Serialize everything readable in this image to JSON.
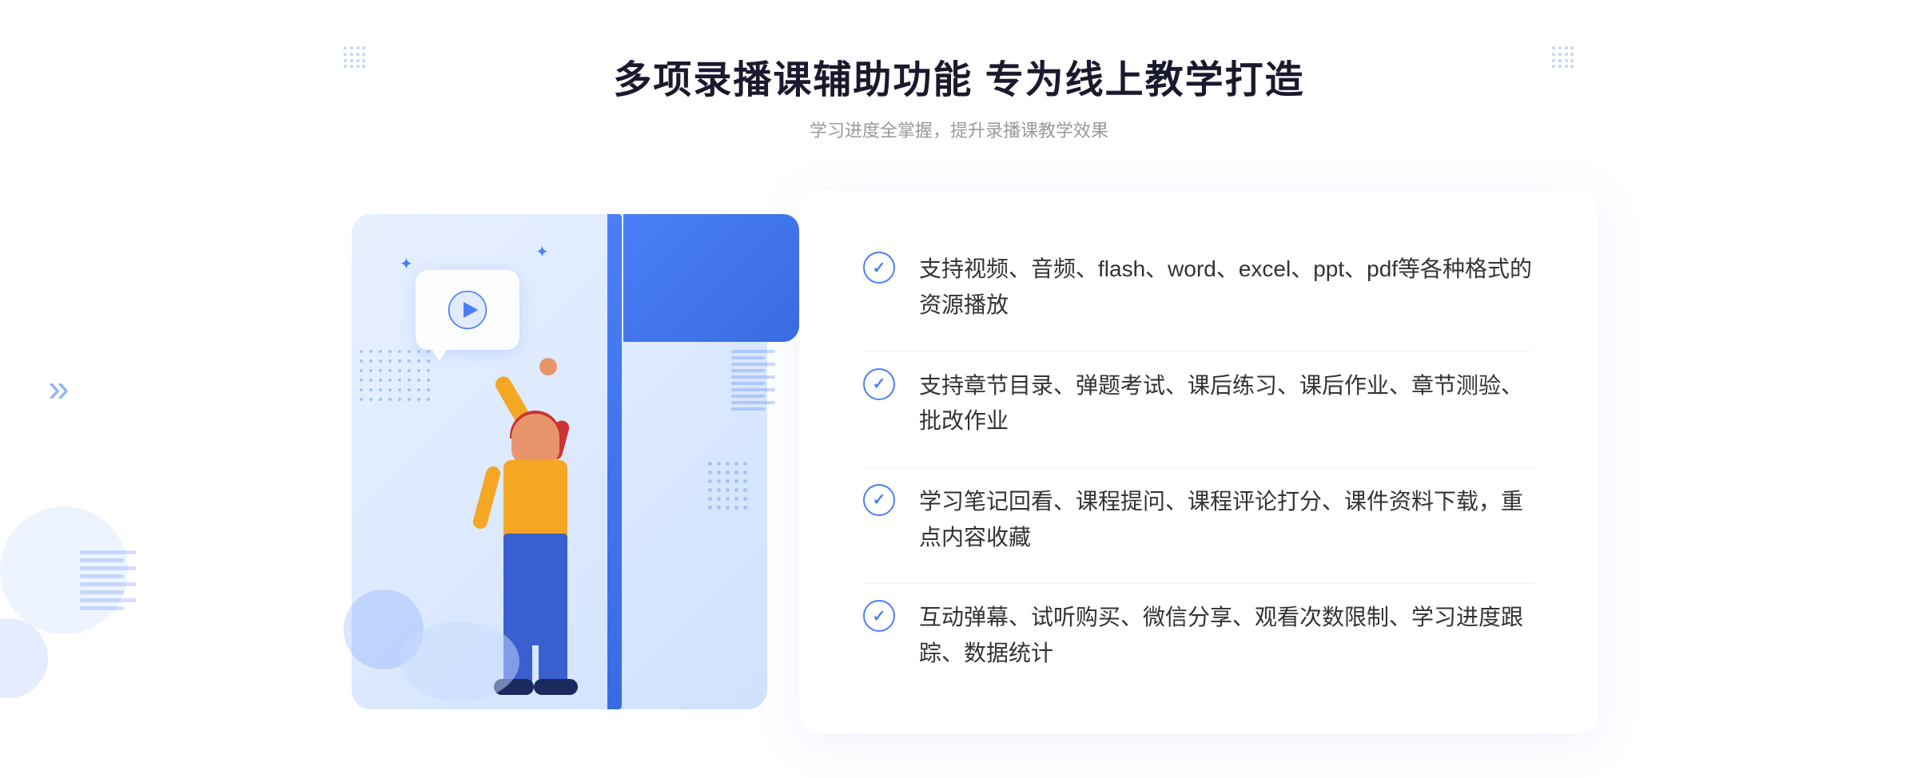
{
  "page": {
    "background_color": "#ffffff"
  },
  "header": {
    "main_title": "多项录播课辅助功能 专为线上教学打造",
    "sub_title": "学习进度全掌握，提升录播课教学效果"
  },
  "features": [
    {
      "id": 1,
      "text": "支持视频、音频、flash、word、excel、ppt、pdf等各种格式的资源播放"
    },
    {
      "id": 2,
      "text": "支持章节目录、弹题考试、课后练习、课后作业、章节测验、批改作业"
    },
    {
      "id": 3,
      "text": "学习笔记回看、课程提问、课程评论打分、课件资料下载，重点内容收藏"
    },
    {
      "id": 4,
      "text": "互动弹幕、试听购买、微信分享、观看次数限制、学习进度跟踪、数据统计"
    }
  ],
  "decorations": {
    "chevron_left": "»",
    "chevron_nav": "«",
    "dots_grid": "····"
  }
}
